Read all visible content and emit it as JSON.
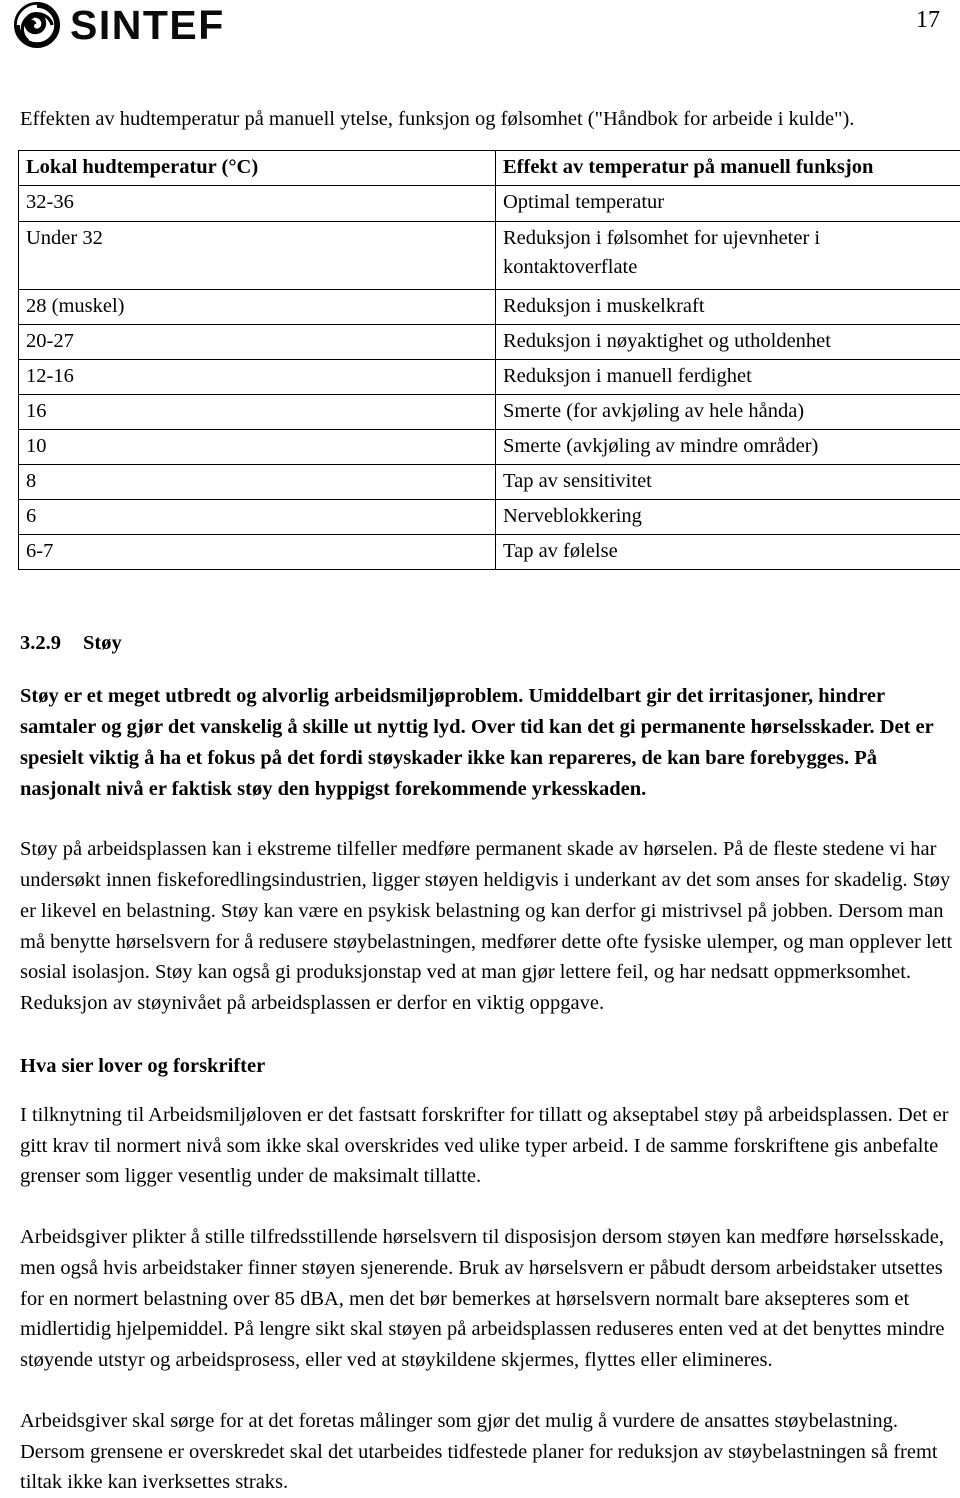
{
  "header": {
    "brand_name": "SINTEF",
    "logo_icon": "sintef-circle-logo-icon",
    "page_number": "17"
  },
  "caption": "Effekten av hudtemperatur på manuell ytelse, funksjon og følsomhet (\"Håndbok for arbeide i kulde\").",
  "table": {
    "columns": [
      "Lokal hudtemperatur (°C)",
      "Effekt av temperatur på manuell funksjon"
    ],
    "rows": [
      {
        "temperature": "32-36",
        "effect": "Optimal temperatur"
      },
      {
        "temperature": "Under 32",
        "effect": "Reduksjon i følsomhet for ujevnheter i kontaktoverflate"
      },
      {
        "temperature": "28 (muskel)",
        "effect": "Reduksjon i muskelkraft"
      },
      {
        "temperature": "20-27",
        "effect": "Reduksjon i nøyaktighet og utholdenhet"
      },
      {
        "temperature": "12-16",
        "effect": "Reduksjon i manuell ferdighet"
      },
      {
        "temperature": "16",
        "effect": "Smerte (for avkjøling av hele hånda)"
      },
      {
        "temperature": "10",
        "effect": "Smerte (avkjøling av mindre områder)"
      },
      {
        "temperature": "8",
        "effect": "Tap av sensitivitet"
      },
      {
        "temperature": "6",
        "effect": "Nerveblokkering"
      },
      {
        "temperature": "6-7",
        "effect": "Tap av følelse"
      }
    ]
  },
  "section": {
    "number": "3.2.9",
    "title": "Støy"
  },
  "paragraphs": {
    "intro_bold": "Støy er et meget utbredt og alvorlig arbeidsmiljøproblem. Umiddelbart gir det irritasjoner, hindrer samtaler og gjør det vanskelig å skille ut nyttig lyd. Over tid kan det gi permanente hørselsskader. Det er spesielt viktig å ha et fokus på det fordi støyskader ikke kan repareres, de kan bare forebygges. På nasjonalt nivå er faktisk støy den hyppigst forekommende yrkesskaden.",
    "body_1": "Støy på arbeidsplassen kan i ekstreme tilfeller medføre permanent skade av hørselen. På de fleste stedene vi har undersøkt innen fiskeforedlingsindustrien, ligger støyen heldigvis i underkant av det som anses for skadelig. Støy er likevel en belastning. Støy kan være en psykisk belastning og kan derfor gi mistrivsel på jobben. Dersom man må benytte hørselsvern for å redusere støybelastningen, medfører dette ofte fysiske ulemper, og man opplever lett sosial isolasjon. Støy kan også gi produksjonstap ved at man gjør lettere feil, og har nedsatt oppmerksomhet. Reduksjon av støynivået på arbeidsplassen er derfor en viktig oppgave.",
    "subheading_law": "Hva sier lover og forskrifter",
    "body_2": "I tilknytning til Arbeidsmiljøloven er det fastsatt forskrifter for tillatt og akseptabel støy på arbeidsplassen. Det er gitt krav til normert nivå som ikke skal overskrides ved ulike typer arbeid. I de samme forskriftene gis anbefalte grenser som ligger vesentlig under de maksimalt tillatte.",
    "body_3": "Arbeidsgiver plikter å stille tilfredsstillende hørselsvern til disposisjon dersom støyen kan medføre hørselsskade, men også hvis arbeidstaker finner støyen sjenerende. Bruk av hørselsvern er påbudt dersom arbeidstaker utsettes for en normert belastning over 85 dBA, men det bør bemerkes at hørselsvern normalt bare aksepteres som et midlertidig hjelpemiddel. På lengre sikt skal støyen på arbeidsplassen reduseres enten ved at det benyttes mindre støyende utstyr og arbeidsprosess, eller ved at støykildene skjermes, flyttes eller elimineres.",
    "body_4": "Arbeidsgiver skal sørge for at det foretas målinger som gjør det mulig å vurdere de ansattes støybelastning. Dersom grensene er overskredet skal det utarbeides tidfestede planer for reduksjon av støybelastningen så fremt tiltak ikke kan iverksettes straks."
  }
}
